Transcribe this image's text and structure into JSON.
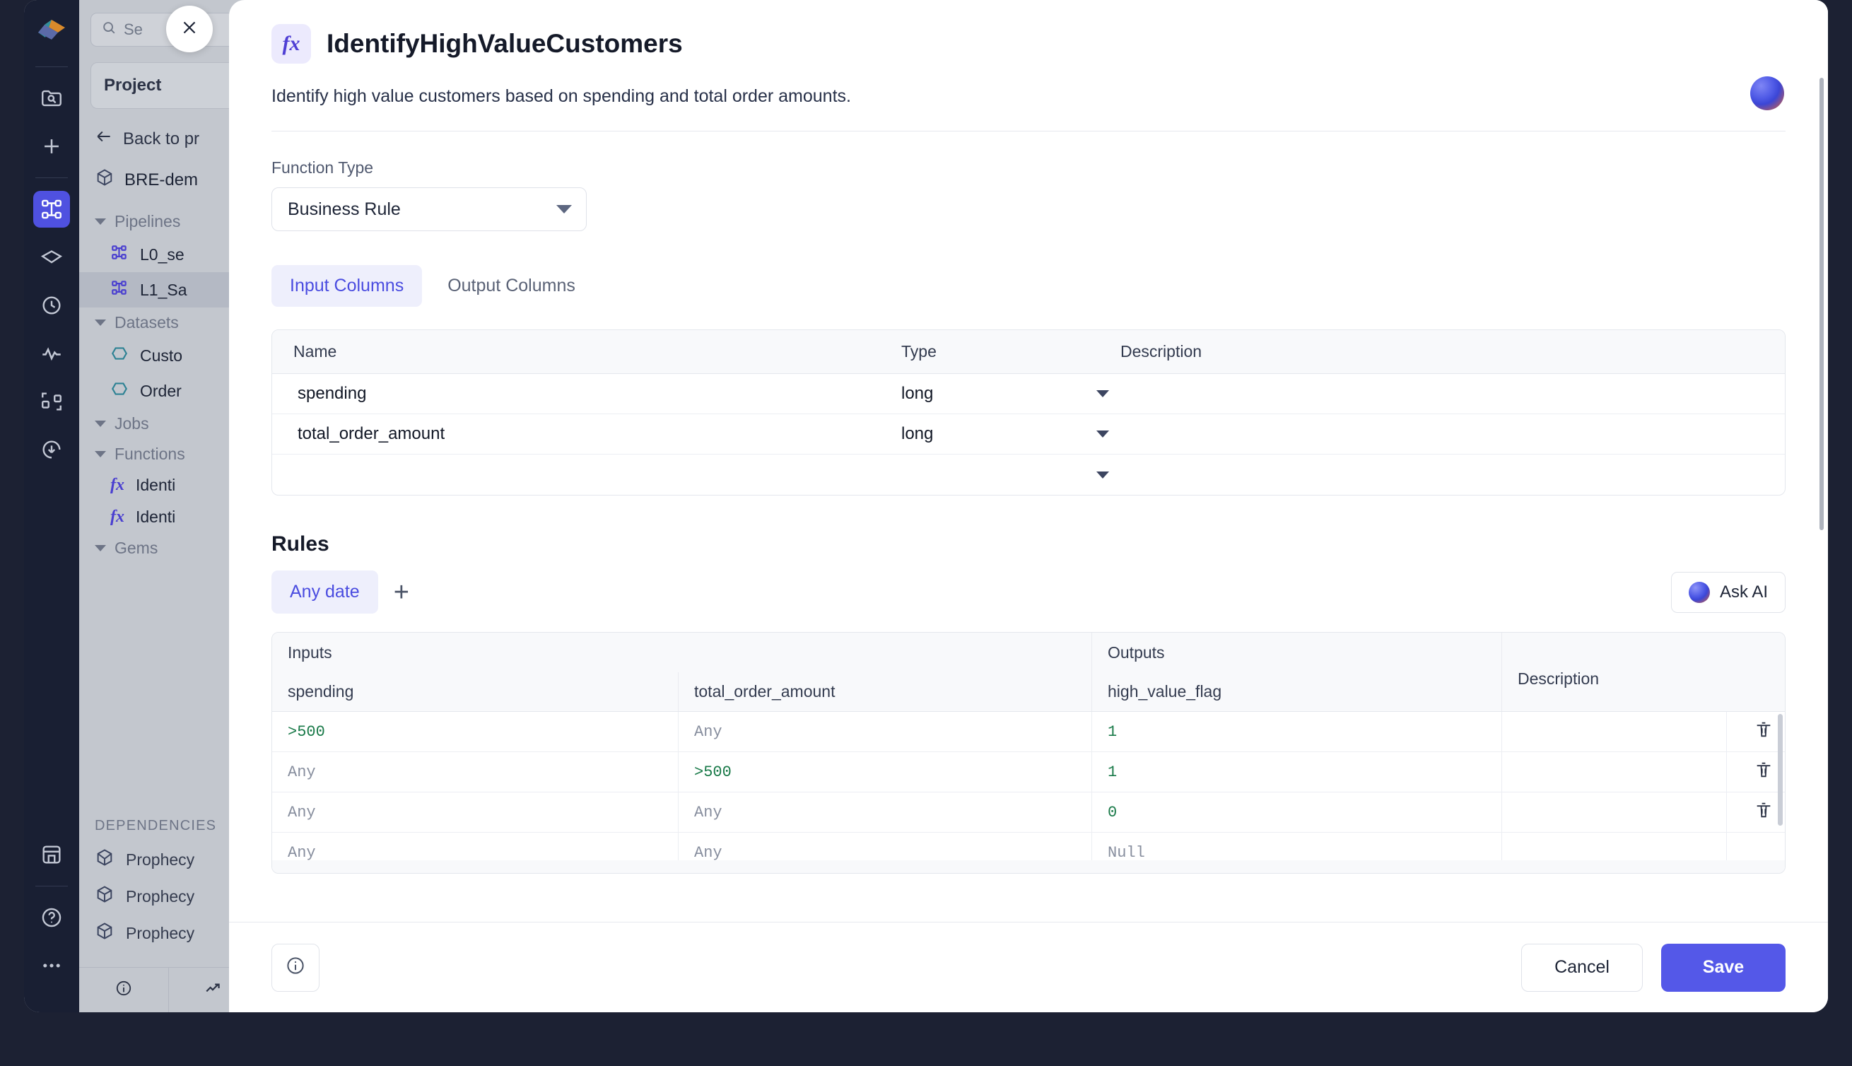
{
  "rail": {
    "logo_icon": "prophecy-logo-icon",
    "items": [
      {
        "name": "search-folder-icon",
        "active": false
      },
      {
        "name": "add-icon",
        "active": false
      },
      {
        "name": "pipelines-icon",
        "active": true
      },
      {
        "name": "gem-icon",
        "active": false
      },
      {
        "name": "history-clock-icon",
        "active": false
      },
      {
        "name": "monitoring-pulse-icon",
        "active": false
      },
      {
        "name": "lineage-icon",
        "active": false
      },
      {
        "name": "deploy-icon",
        "active": false
      }
    ],
    "bottom_items": [
      {
        "name": "marketplace-icon"
      },
      {
        "name": "help-icon"
      },
      {
        "name": "more-icon"
      }
    ]
  },
  "sidebar": {
    "search_placeholder": "Se",
    "project_card": "Project",
    "back_link": "Back to pr",
    "repo_name": "BRE-dem",
    "groups": [
      {
        "label": "Pipelines",
        "items": [
          {
            "label": "L0_se",
            "icon": "pipeline-icon",
            "selected": false
          },
          {
            "label": "L1_Sa",
            "icon": "pipeline-icon",
            "selected": true
          }
        ]
      },
      {
        "label": "Datasets",
        "items": [
          {
            "label": "Custo",
            "icon": "dataset-icon",
            "selected": false
          },
          {
            "label": "Order",
            "icon": "dataset-icon",
            "selected": false
          }
        ]
      },
      {
        "label": "Jobs",
        "items": []
      },
      {
        "label": "Functions",
        "items": [
          {
            "label": "Identi",
            "icon": "function-fx-icon",
            "selected": false
          },
          {
            "label": "Identi",
            "icon": "function-fx-icon",
            "selected": false
          }
        ]
      },
      {
        "label": "Gems",
        "items": []
      }
    ],
    "dependencies_title": "DEPENDENCIES",
    "dependencies": [
      {
        "label": "Prophecy",
        "icon": "package-open-icon"
      },
      {
        "label": "Prophecy",
        "icon": "package-icon"
      },
      {
        "label": "Prophecy",
        "icon": "package-icon"
      }
    ],
    "bottom_bar": [
      {
        "name": "info-icon"
      },
      {
        "name": "trend-icon"
      },
      {
        "name": "code-icon"
      }
    ]
  },
  "modal": {
    "close_label": "✕",
    "fx_badge": "fx",
    "title": "IdentifyHighValueCustomers",
    "description": "Identify high value customers based on spending and total order amounts.",
    "function_type_label": "Function Type",
    "function_type_value": "Business Rule",
    "tabs": [
      {
        "label": "Input Columns",
        "active": true
      },
      {
        "label": "Output Columns",
        "active": false
      }
    ],
    "columns_table": {
      "headers": [
        "Name",
        "Type",
        "Description"
      ],
      "rows": [
        {
          "name": "spending",
          "type": "long",
          "description": ""
        },
        {
          "name": "total_order_amount",
          "type": "long",
          "description": ""
        },
        {
          "name": "",
          "type": "",
          "description": ""
        }
      ]
    },
    "rules": {
      "title": "Rules",
      "chip": "Any date",
      "add_label": "+",
      "ask_ai_label": "Ask AI",
      "group_headers": [
        "Inputs",
        "Outputs",
        "Description"
      ],
      "column_headers": [
        "spending",
        "total_order_amount",
        "high_value_flag"
      ],
      "rows": [
        {
          "spending": ">500",
          "spending_style": "green",
          "total_order_amount": "Any",
          "total_order_amount_style": "any",
          "high_value_flag": "1",
          "high_value_flag_style": "green",
          "description": "",
          "deletable": true
        },
        {
          "spending": "Any",
          "spending_style": "any",
          "total_order_amount": ">500",
          "total_order_amount_style": "green",
          "high_value_flag": "1",
          "high_value_flag_style": "green",
          "description": "",
          "deletable": true
        },
        {
          "spending": "Any",
          "spending_style": "any",
          "total_order_amount": "Any",
          "total_order_amount_style": "any",
          "high_value_flag": "0",
          "high_value_flag_style": "green",
          "description": "",
          "deletable": true
        },
        {
          "spending": "Any",
          "spending_style": "any",
          "total_order_amount": "Any",
          "total_order_amount_style": "any",
          "high_value_flag": "Null",
          "high_value_flag_style": "null",
          "description": "",
          "deletable": false
        }
      ]
    },
    "footer": {
      "info_icon": "info-icon",
      "cancel_label": "Cancel",
      "save_label": "Save"
    }
  },
  "colors": {
    "accent": "#5458e8",
    "tab_active_text": "#4a4ce0",
    "tab_active_bg": "#eeeffc",
    "value_green": "#1a7a49",
    "muted": "#878e9e"
  }
}
